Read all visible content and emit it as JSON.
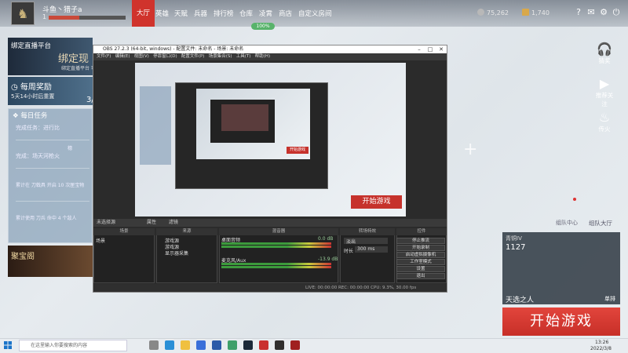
{
  "player": {
    "name": "斗鱼丶猎子a",
    "level": "1"
  },
  "nav": {
    "items": [
      "大厅",
      "英雄",
      "天赋",
      "兵器",
      "排行榜",
      "仓库",
      "凌霄",
      "商店",
      "自定义房间"
    ],
    "status_pill": "100%"
  },
  "currency": {
    "gold": "75,262",
    "gems": "1,740"
  },
  "left_panel": {
    "bind_title": "绑定直播平台",
    "bind_big": "绑定现",
    "bind_sub": "绑定直播平台 可获得丰厚奖励",
    "weekly_title": "每周奖励",
    "weekly_sub": "5天14小时后重置",
    "weekly_progress": "3/",
    "daily_title": "每日任务",
    "tasks": [
      "完成任务：进行比",
      "完成：场天河枪火",
      "累计在 刀戟具 开启 10 次匣宝物",
      "累计使用 刀兵 命中 4 个敌人"
    ],
    "task_mark": "穗",
    "treasure": "聚宝阁"
  },
  "right_panel": {
    "icons": [
      {
        "label": "猜奖",
        "icon": "headset-icon"
      },
      {
        "label": "推荐关注",
        "icon": "camera-icon"
      },
      {
        "label": "传火",
        "icon": "flame-icon"
      }
    ],
    "team_center": "组队中心",
    "team_hall": "组队大厅"
  },
  "friend": {
    "name": "青铜IV",
    "id": "1127",
    "mode": "天选之人",
    "tag": "单排"
  },
  "start_button": "开始游戏",
  "obs": {
    "title": "OBS 27.2.3 (64-bit, windows) - 配置文件: 未命名 - 场景: 未命名",
    "menu": [
      "文件(F)",
      "编辑(E)",
      "视图(V)",
      "停靠窗口(D)",
      "配置文件(P)",
      "场景集合(S)",
      "工具(T)",
      "帮助(H)"
    ],
    "preview_start": "开始游戏",
    "nested_start": "开始游戏",
    "mid_label": "未选择源",
    "mid_buttons": [
      "属性",
      "滤镜"
    ],
    "docks": {
      "scenes_title": "场景",
      "scenes": [
        "场景"
      ],
      "sources_title": "来源",
      "sources": [
        "游戏源",
        "游戏源",
        "显示器采集"
      ],
      "mixer_title": "混音器",
      "mixer_tracks": [
        {
          "name": "桌面音频",
          "db": "0.0 dB"
        },
        {
          "name": "麦克风/Aux",
          "db": "-13.9 dB"
        }
      ],
      "transitions_title": "转场特效",
      "transition_type": "淡出",
      "duration_label": "时长",
      "duration_value": "300 ms",
      "controls_title": "控件",
      "controls": [
        "停止推流",
        "开始录制",
        "启动虚拟摄像机",
        "工作室模式",
        "设置",
        "退出"
      ]
    },
    "status": "LIVE: 00:00:00   REC: 00:00:00   CPU: 9.3%, 30.00 fps"
  },
  "taskbar": {
    "search_placeholder": "在这里输入你要搜索的内容",
    "time": "13:26",
    "date": "2022/3/8"
  },
  "colors": {
    "accent_red": "#d0332c",
    "live_green": "#58b36b"
  }
}
